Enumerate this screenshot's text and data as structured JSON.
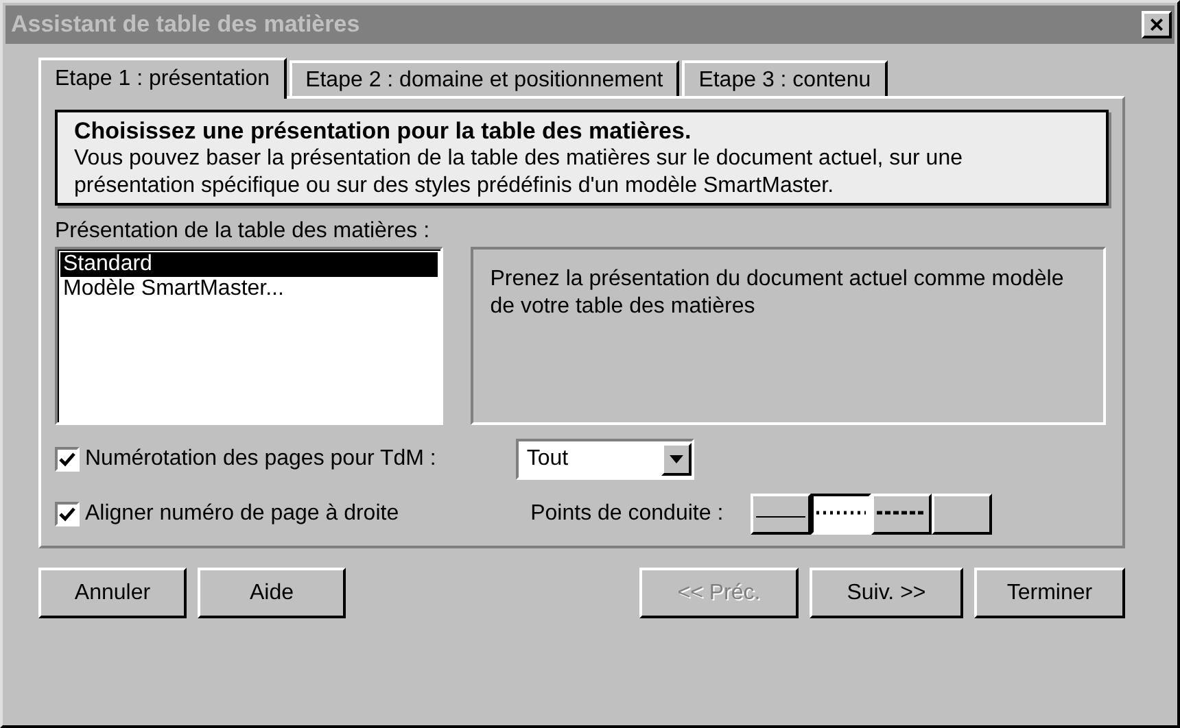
{
  "window": {
    "title": "Assistant de table des matières",
    "close": "×"
  },
  "tabs": [
    {
      "label": "Etape 1 : présentation",
      "selected": true
    },
    {
      "label": "Etape 2 : domaine et positionnement",
      "selected": false
    },
    {
      "label": "Etape 3 : contenu",
      "selected": false
    }
  ],
  "info": {
    "heading": "Choisissez une présentation pour la table des matières.",
    "text": "Vous pouvez baser la présentation de la table des matières sur le document actuel, sur une présentation spécifique ou sur des styles prédéfinis d'un modèle SmartMaster."
  },
  "presentation": {
    "label": "Présentation de la table des matières :",
    "items": [
      {
        "label": "Standard",
        "selected": true
      },
      {
        "label": "Modèle SmartMaster...",
        "selected": false
      }
    ],
    "description": "Prenez la présentation du document actuel comme modèle de votre  table des matières"
  },
  "numbering": {
    "label": "Numérotation des pages pour TdM :",
    "checked": true,
    "value": "Tout"
  },
  "align": {
    "label": "Aligner numéro de page à droite",
    "checked": true
  },
  "leaders": {
    "label": "Points de conduite :",
    "options": [
      {
        "kind": "solid",
        "selected": false
      },
      {
        "kind": "dotted",
        "selected": true
      },
      {
        "kind": "dashed",
        "selected": false
      },
      {
        "kind": "none",
        "selected": false
      }
    ]
  },
  "buttons": [
    {
      "label": "Annuler",
      "disabled": false
    },
    {
      "label": "Aide",
      "disabled": false
    },
    {
      "label": "<< Préc.",
      "disabled": true
    },
    {
      "label": "Suiv. >>",
      "disabled": false
    },
    {
      "label": "Terminer",
      "disabled": false
    }
  ]
}
